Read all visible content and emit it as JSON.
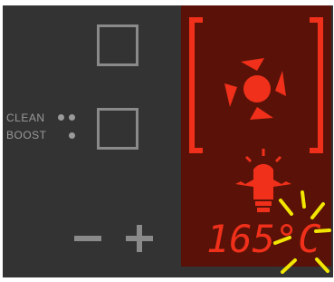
{
  "controls": {
    "clean_label": "CLEAN",
    "boost_label": "BOOST"
  },
  "display": {
    "temperature": "165",
    "unit": "°C",
    "fan_icon": "convection-fan-icon",
    "light_icon": "oven-light-icon"
  },
  "colors": {
    "panel": "#333333",
    "display_bg": "#5a1208",
    "active_red": "#f0301a",
    "inactive_gray": "#8a8a8a",
    "spark_yellow": "#f2e600"
  }
}
